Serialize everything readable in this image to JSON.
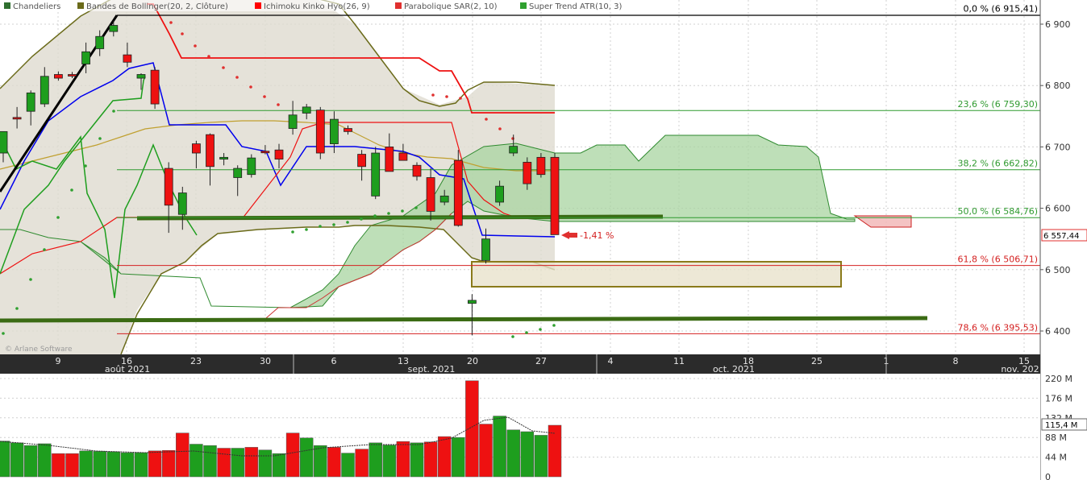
{
  "legend": [
    {
      "label": "Chandeliers",
      "color": "#2f6f2f"
    },
    {
      "label": "Bandes de Bollinger(20, 2, Clôture)",
      "color": "#6b6b1a"
    },
    {
      "label": "Ichimoku Kinko Hyo(26, 9)",
      "color": "#ff0000"
    },
    {
      "label": "Parabolique SAR(2, 10)",
      "color": "#e0302f"
    },
    {
      "label": "Super Trend ATR(10, 3)",
      "color": "#2fa02f"
    }
  ],
  "watermark": "© Arlane Software",
  "price_badge": "6 557,44",
  "volume_badge": "115,4 M",
  "change_annotation": "-1,41 %",
  "colors": {
    "up": "#1e9e1e",
    "down": "#ee1111",
    "grid": "#d0d0d0",
    "dark_green": "#3b6b14",
    "fib_green": "#2f9a2f",
    "fib_red": "#d42020",
    "bollinger": "#6b6b1a",
    "tenkan": "#0000ee",
    "kijun": "#ee0000"
  },
  "chart_data": [
    {
      "type": "candlestick",
      "title": "",
      "x_tick_labels": [
        "9",
        "16",
        "23",
        "30",
        "6",
        "13",
        "20",
        "27",
        "4",
        "11",
        "18",
        "25",
        "1",
        "8",
        "15"
      ],
      "month_labels": [
        "août 2021",
        "sept. 2021",
        "oct. 2021",
        "nov. 202"
      ],
      "y_tick_labels": [
        "6 900",
        "6 800",
        "6 700",
        "6 600",
        "6 500",
        "6 400"
      ],
      "ylim": [
        6373,
        6940
      ],
      "grid": true,
      "fibonacci_levels": [
        {
          "label": "0,0 % (6 915,41)",
          "value": 6915.41
        },
        {
          "label": "23,6 % (6 759,30)",
          "value": 6759.3
        },
        {
          "label": "38,2 % (6 662,82)",
          "value": 6662.82
        },
        {
          "label": "50,0 % (6 584,76)",
          "value": 6584.76
        },
        {
          "label": "61,8 % (6 506,71)",
          "value": 6506.71
        },
        {
          "label": "78,6 % (6 395,53)",
          "value": 6395.53
        }
      ],
      "last_price": 6557.44,
      "candles": [
        {
          "o": 6690,
          "h": 6722,
          "l": 6675,
          "c": 6725
        },
        {
          "o": 6748,
          "h": 6765,
          "l": 6730,
          "c": 6746
        },
        {
          "o": 6758,
          "h": 6792,
          "l": 6735,
          "c": 6788
        },
        {
          "o": 6770,
          "h": 6830,
          "l": 6765,
          "c": 6815
        },
        {
          "o": 6818,
          "h": 6823,
          "l": 6808,
          "c": 6812
        },
        {
          "o": 6818,
          "h": 6822,
          "l": 6812,
          "c": 6816
        },
        {
          "o": 6835,
          "h": 6870,
          "l": 6820,
          "c": 6855
        },
        {
          "o": 6860,
          "h": 6890,
          "l": 6848,
          "c": 6880
        },
        {
          "o": 6888,
          "h": 6905,
          "l": 6880,
          "c": 6898
        },
        {
          "o": 6850,
          "h": 6870,
          "l": 6830,
          "c": 6838
        },
        {
          "o": 6812,
          "h": 6820,
          "l": 6793,
          "c": 6818
        },
        {
          "o": 6825,
          "h": 6830,
          "l": 6762,
          "c": 6770
        },
        {
          "o": 6665,
          "h": 6675,
          "l": 6560,
          "c": 6605
        },
        {
          "o": 6590,
          "h": 6635,
          "l": 6565,
          "c": 6625
        },
        {
          "o": 6705,
          "h": 6710,
          "l": 6665,
          "c": 6690
        },
        {
          "o": 6720,
          "h": 6722,
          "l": 6637,
          "c": 6668
        },
        {
          "o": 6680,
          "h": 6690,
          "l": 6670,
          "c": 6683
        },
        {
          "o": 6650,
          "h": 6670,
          "l": 6620,
          "c": 6665
        },
        {
          "o": 6655,
          "h": 6688,
          "l": 6650,
          "c": 6682
        },
        {
          "o": 6693,
          "h": 6703,
          "l": 6688,
          "c": 6691
        },
        {
          "o": 6695,
          "h": 6705,
          "l": 6665,
          "c": 6680
        },
        {
          "o": 6730,
          "h": 6775,
          "l": 6720,
          "c": 6752
        },
        {
          "o": 6755,
          "h": 6770,
          "l": 6745,
          "c": 6765
        },
        {
          "o": 6760,
          "h": 6765,
          "l": 6680,
          "c": 6690
        },
        {
          "o": 6705,
          "h": 6758,
          "l": 6690,
          "c": 6745
        },
        {
          "o": 6730,
          "h": 6735,
          "l": 6720,
          "c": 6725
        },
        {
          "o": 6688,
          "h": 6695,
          "l": 6645,
          "c": 6668
        },
        {
          "o": 6620,
          "h": 6700,
          "l": 6615,
          "c": 6690
        },
        {
          "o": 6700,
          "h": 6722,
          "l": 6670,
          "c": 6660
        },
        {
          "o": 6690,
          "h": 6705,
          "l": 6678,
          "c": 6678
        },
        {
          "o": 6670,
          "h": 6675,
          "l": 6645,
          "c": 6652
        },
        {
          "o": 6650,
          "h": 6665,
          "l": 6580,
          "c": 6595
        },
        {
          "o": 6610,
          "h": 6630,
          "l": 6605,
          "c": 6620
        },
        {
          "o": 6678,
          "h": 6695,
          "l": 6570,
          "c": 6572
        },
        {
          "o": 6445,
          "h": 6460,
          "l": 6393,
          "c": 6450
        },
        {
          "o": 6515,
          "h": 6567,
          "l": 6510,
          "c": 6550
        },
        {
          "o": 6610,
          "h": 6645,
          "l": 6604,
          "c": 6636
        },
        {
          "o": 6690,
          "h": 6720,
          "l": 6685,
          "c": 6701
        },
        {
          "o": 6675,
          "h": 6683,
          "l": 6630,
          "c": 6640
        },
        {
          "o": 6683,
          "h": 6690,
          "l": 6650,
          "c": 6655
        },
        {
          "o": 6683,
          "h": 6690,
          "l": 6560,
          "c": 6557
        }
      ],
      "volume": {
        "y_tick_labels": [
          "220 M",
          "176 M",
          "132 M",
          "88 M",
          "44 M",
          "0"
        ],
        "ylim": [
          0,
          220
        ],
        "values": [
          80,
          76,
          70,
          74,
          52,
          52,
          58,
          57,
          56,
          54,
          54,
          58,
          59,
          98,
          73,
          70,
          64,
          64,
          66,
          60,
          52,
          98,
          87,
          70,
          66,
          53,
          62,
          76,
          71,
          79,
          76,
          78,
          90,
          88,
          215,
          118,
          136,
          105,
          101,
          93,
          115.4
        ],
        "up": [
          true,
          true,
          true,
          true,
          false,
          false,
          true,
          true,
          true,
          true,
          true,
          false,
          false,
          false,
          true,
          true,
          false,
          true,
          false,
          true,
          true,
          false,
          true,
          true,
          false,
          true,
          false,
          true,
          true,
          false,
          true,
          false,
          false,
          true,
          false,
          false,
          true,
          true,
          true,
          true,
          false
        ]
      }
    }
  ]
}
